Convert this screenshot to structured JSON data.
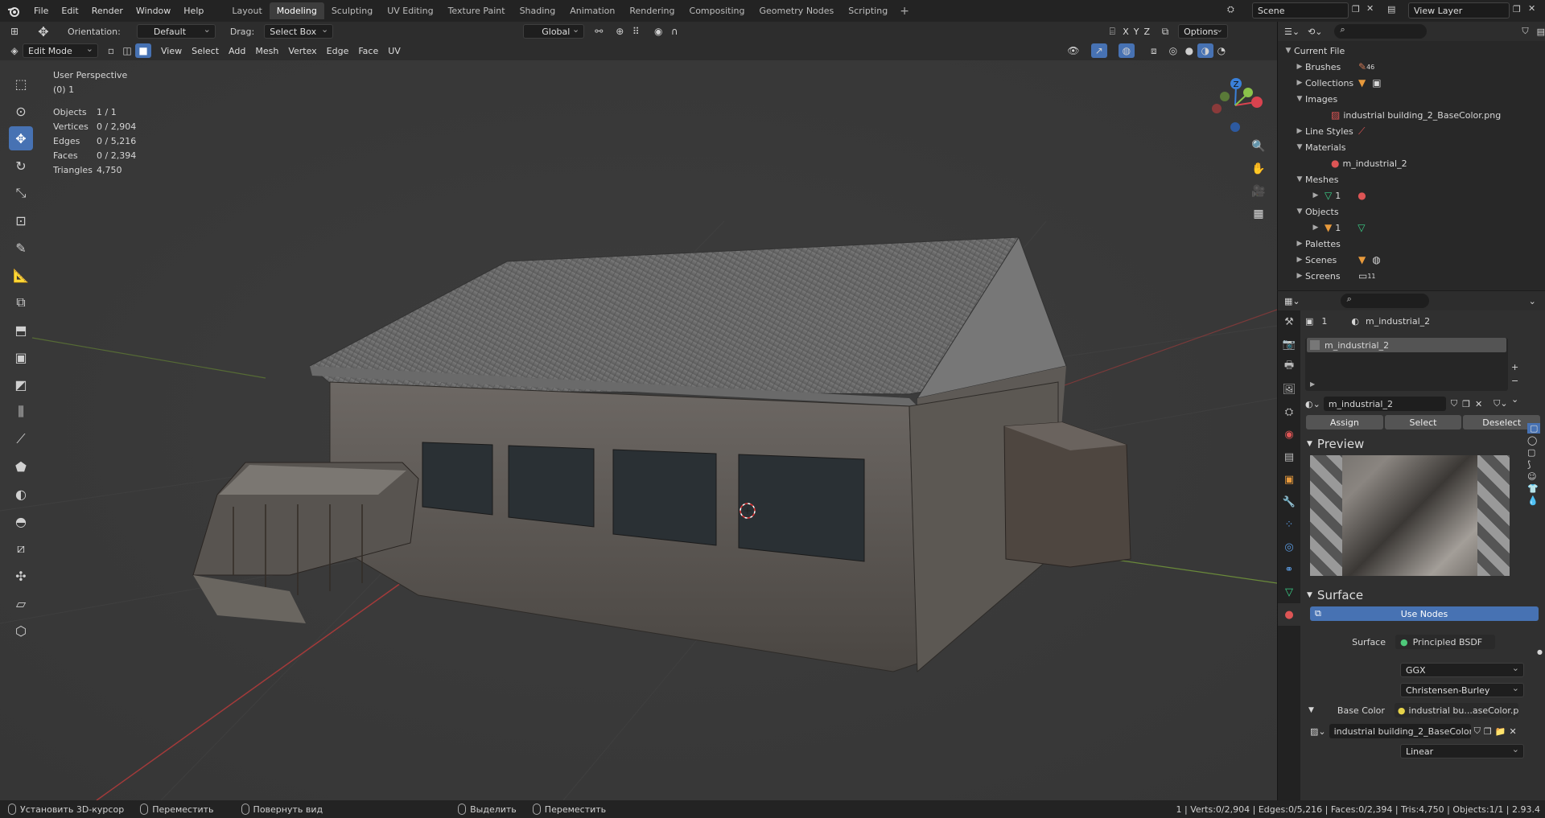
{
  "menu": [
    "File",
    "Edit",
    "Render",
    "Window",
    "Help"
  ],
  "workspaces": [
    "Layout",
    "Modeling",
    "Sculpting",
    "UV Editing",
    "Texture Paint",
    "Shading",
    "Animation",
    "Rendering",
    "Compositing",
    "Geometry Nodes",
    "Scripting"
  ],
  "active_workspace": "Modeling",
  "scene": "Scene",
  "view_layer": "View Layer",
  "header": {
    "orientation_label": "Orientation:",
    "orientation_value": "Default",
    "drag_label": "Drag:",
    "drag_value": "Select Box",
    "transform_orientation": "Global",
    "options": "Options",
    "axes": [
      "X",
      "Y",
      "Z"
    ]
  },
  "header2": {
    "mode": "Edit Mode",
    "menus": [
      "View",
      "Select",
      "Add",
      "Mesh",
      "Vertex",
      "Edge",
      "Face",
      "UV"
    ]
  },
  "viewport": {
    "perspective": "User Perspective",
    "collection": "(0) 1",
    "stats": [
      {
        "k": "Objects",
        "v": "1 / 1"
      },
      {
        "k": "Vertices",
        "v": "0 / 2,904"
      },
      {
        "k": "Edges",
        "v": "0 / 5,216"
      },
      {
        "k": "Faces",
        "v": "0 / 2,394"
      },
      {
        "k": "Triangles",
        "v": "4,750"
      }
    ],
    "gizmo_labels": {
      "z": "Z",
      "y": "Y",
      "x": "X"
    }
  },
  "outliner": {
    "root": "Current File",
    "items": [
      {
        "label": "Brushes",
        "expanded": false,
        "depth": 1,
        "extra": "46"
      },
      {
        "label": "Collections",
        "expanded": false,
        "depth": 1
      },
      {
        "label": "Images",
        "expanded": true,
        "depth": 1
      },
      {
        "label": "industrial building_2_BaseColor.png",
        "depth": 2
      },
      {
        "label": "Line Styles",
        "expanded": false,
        "depth": 1
      },
      {
        "label": "Materials",
        "expanded": true,
        "depth": 1
      },
      {
        "label": "m_industrial_2",
        "depth": 2
      },
      {
        "label": "Meshes",
        "expanded": true,
        "depth": 1
      },
      {
        "label": "1",
        "depth": 2,
        "expandable": true
      },
      {
        "label": "Objects",
        "expanded": true,
        "depth": 1
      },
      {
        "label": "1",
        "depth": 2,
        "expandable": true
      },
      {
        "label": "Palettes",
        "expanded": false,
        "depth": 1
      },
      {
        "label": "Scenes",
        "expanded": false,
        "depth": 1
      },
      {
        "label": "Screens",
        "expanded": false,
        "depth": 1,
        "extra": "11"
      }
    ]
  },
  "properties": {
    "object": "1",
    "material": "m_industrial_2",
    "slot": "m_industrial_2",
    "material_field": "m_industrial_2",
    "assign": "Assign",
    "select": "Select",
    "deselect": "Deselect",
    "preview": "Preview",
    "surface_panel": "Surface",
    "use_nodes": "Use Nodes",
    "surface_label": "Surface",
    "surface_value": "Principled BSDF",
    "distribution": "GGX",
    "subsurface": "Christensen-Burley",
    "base_color_label": "Base Color",
    "base_color_value": "industrial bu...aseColor.png",
    "image_field": "industrial building_2_BaseColor...",
    "interpolation": "Linear"
  },
  "statusbar": {
    "items": [
      "Установить 3D-курсор",
      "Переместить",
      "Повернуть вид",
      "Выделить",
      "Переместить"
    ],
    "info": "1 | Verts:0/2,904 | Edges:0/5,216 | Faces:0/2,394 | Tris:4,750 | Objects:1/1 | 2.93.4"
  },
  "colors": {
    "accent": "#4772b3",
    "x_axis": "#d9434f",
    "y_axis": "#8bc34a",
    "z_axis": "#3a80d9"
  }
}
